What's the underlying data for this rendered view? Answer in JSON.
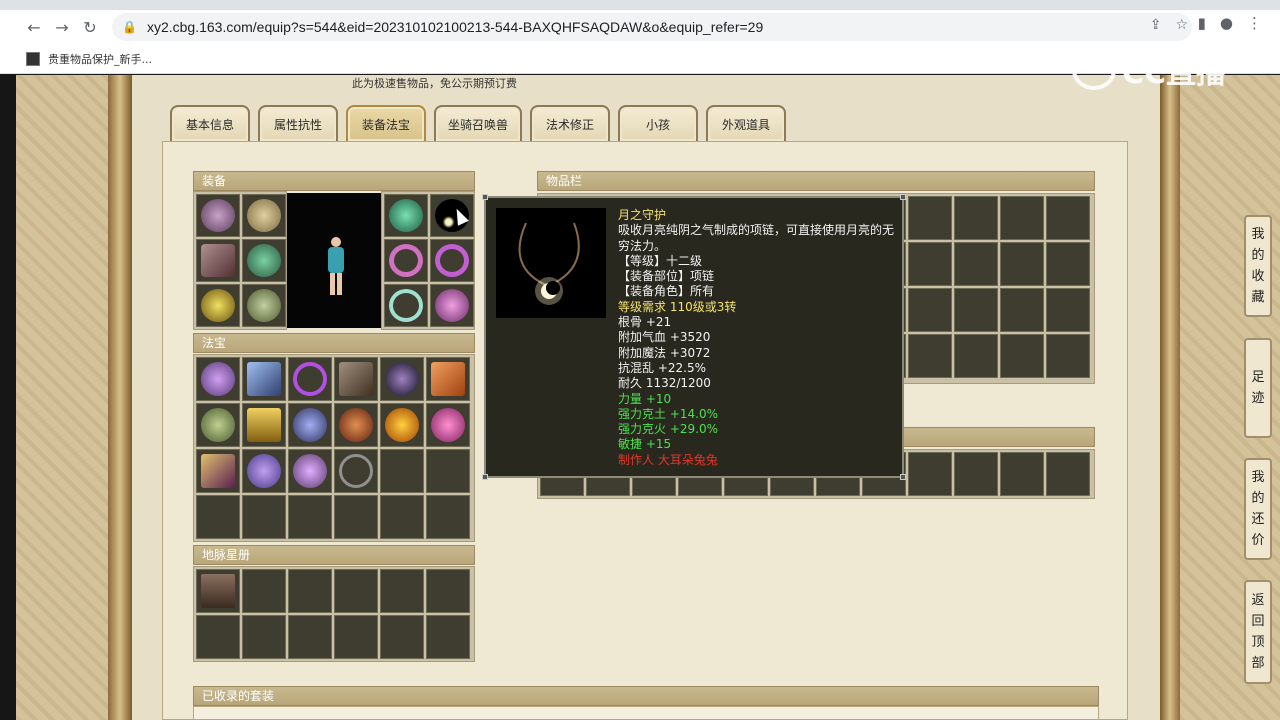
{
  "browser": {
    "url": "xy2.cbg.163.com/equip?s=544&eid=202310102100213-544-BAXQHFSAQDAW&o&equip_refer=29",
    "bookmark": "贵重物品保护_新手..."
  },
  "page": {
    "notice": "此为极速售物品，免公示期预订费",
    "tabs": [
      "基本信息",
      "属性抗性",
      "装备法宝",
      "坐骑召唤兽",
      "法术修正",
      "小孩",
      "外观道具"
    ],
    "active_tab": "装备法宝",
    "sections": {
      "equipment": "装备",
      "fabao": "法宝",
      "dimai": "地脉星册",
      "inventory": "物品栏",
      "suits": "已收录的套装"
    },
    "side_buttons": [
      {
        "label": "我的收藏",
        "chars": [
          "我",
          "的",
          "收",
          "藏"
        ]
      },
      {
        "label": "足迹",
        "chars": [
          "足",
          "迹"
        ]
      },
      {
        "label": "我的还价",
        "chars": [
          "我",
          "的",
          "还",
          "价"
        ]
      },
      {
        "label": "返回顶部",
        "chars": [
          "返",
          "回",
          "顶",
          "部"
        ]
      }
    ]
  },
  "tooltip": {
    "name": "月之守护",
    "desc": "吸收月亮纯阴之气制成的项链，可直接使用月亮的无穷法力。",
    "level": "【等级】十二级",
    "slot": "【装备部位】项链",
    "role": "【装备角色】所有",
    "require": "等级需求 110级或3转",
    "attrs_white": [
      "根骨 +21",
      "附加气血 +3520",
      "附加魔法 +3072",
      "抗混乱 +22.5%",
      "耐久 1132/1200"
    ],
    "attrs_green": [
      "力量 +10",
      "强力克土 +14.0%",
      "强力克火 +29.0%",
      "敏捷 +15"
    ],
    "maker": "制作人 大耳朵兔兔"
  },
  "watermark": "CC直播",
  "colors": {
    "accent_tab": "#d8c28a",
    "tip_yellow": "#f5e26a",
    "tip_green": "#4fe04f",
    "tip_red": "#e0392b"
  }
}
